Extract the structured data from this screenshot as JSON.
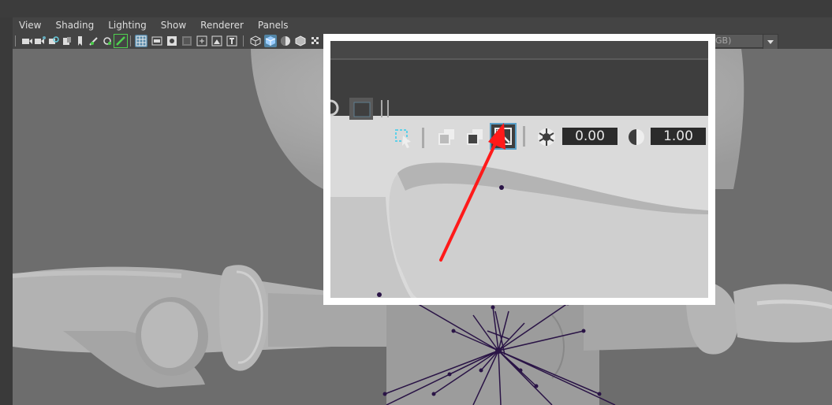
{
  "menu": {
    "items": [
      "View",
      "Shading",
      "Lighting",
      "Show",
      "Renderer",
      "Panels"
    ]
  },
  "toolbar": {
    "colorspace_text": "GB)",
    "icons": [
      "camera-select-icon",
      "camera-attributes-icon",
      "bookmark-icon",
      "image-plane-icon",
      "2d-pan-zoom-icon",
      "grease-pencil-icon",
      "grid-icon",
      "film-gate-icon",
      "resolution-gate-icon",
      "gate-mask-icon",
      "field-chart-icon",
      "safe-action-icon",
      "safe-title-icon",
      "wireframe-icon",
      "smooth-shade-icon",
      "use-default-material-icon",
      "wireframe-on-shaded-icon",
      "xray-icon"
    ]
  },
  "callout": {
    "exposure_value": "0.00",
    "gamma_value": "1.00",
    "highlighted_button": "color-management-toggle-icon",
    "arrow_color": "#ff1a1a"
  },
  "colors": {
    "viewport_bg": "#6d6d6d",
    "highlight_blue": "#5285a6",
    "joint_color": "#2a1446"
  }
}
